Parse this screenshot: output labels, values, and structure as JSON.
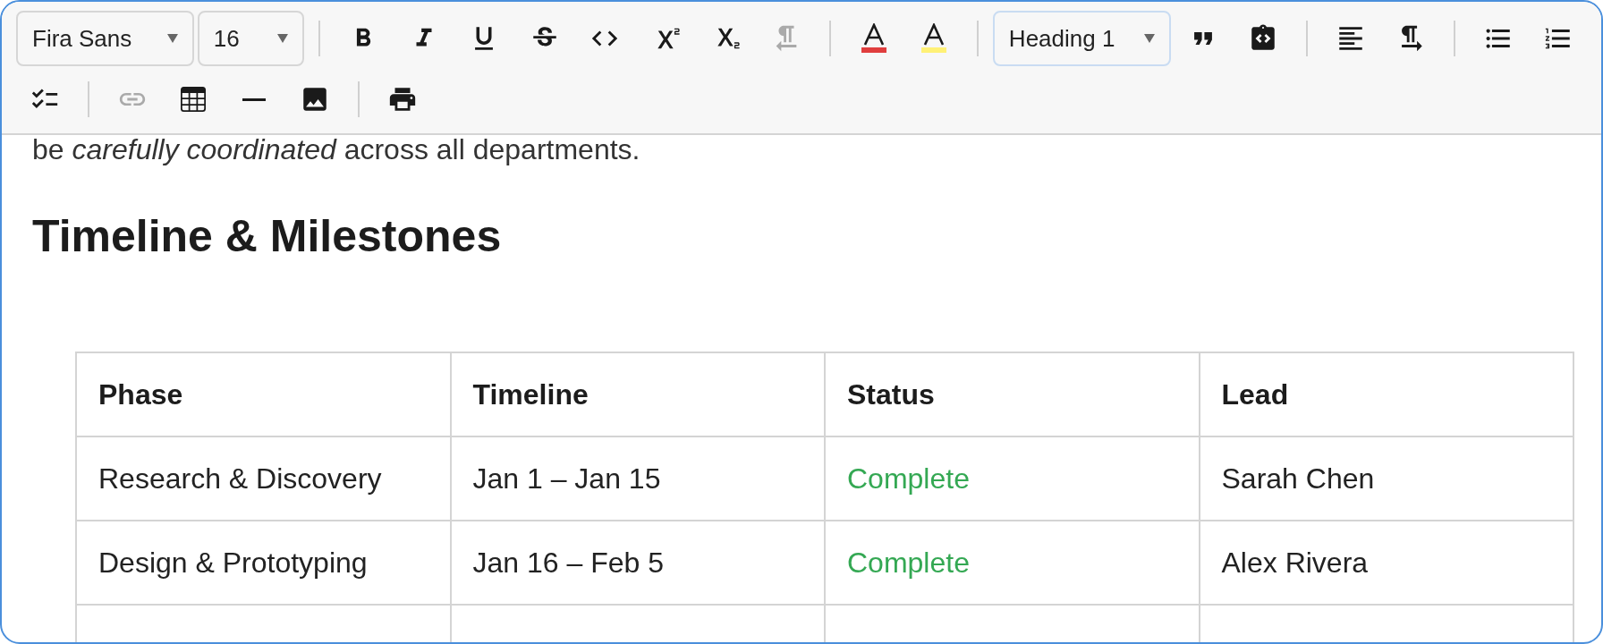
{
  "toolbar": {
    "rows": [
      [
        {
          "kind": "select",
          "value": "Fira Sans",
          "focused": false
        },
        {
          "kind": "select",
          "value": "16",
          "focused": false
        },
        {
          "kind": "separator"
        },
        {
          "kind": "button",
          "disabled": false
        },
        {
          "kind": "button",
          "disabled": false
        },
        {
          "kind": "button",
          "disabled": false
        },
        {
          "kind": "button",
          "disabled": false
        },
        {
          "kind": "button",
          "disabled": false
        },
        {
          "kind": "button",
          "disabled": false
        },
        {
          "kind": "button",
          "disabled": false
        },
        {
          "kind": "button",
          "disabled": true
        },
        {
          "kind": "separator"
        },
        {
          "kind": "color",
          "color": "#e03e3e",
          "disabled": false
        },
        {
          "kind": "color",
          "color": "#fff176",
          "disabled": false
        },
        {
          "kind": "separator"
        },
        {
          "kind": "select",
          "value": "Heading 1",
          "focused": true
        },
        {
          "kind": "button",
          "disabled": false
        },
        {
          "kind": "button",
          "disabled": false
        },
        {
          "kind": "separator"
        },
        {
          "kind": "button",
          "disabled": false
        },
        {
          "kind": "button",
          "disabled": false
        },
        {
          "kind": "separator"
        },
        {
          "kind": "button",
          "disabled": false
        },
        {
          "kind": "button",
          "disabled": false
        }
      ],
      [
        {
          "kind": "button",
          "disabled": false
        },
        {
          "kind": "separator"
        },
        {
          "kind": "button",
          "disabled": true
        },
        {
          "kind": "button",
          "disabled": false
        },
        {
          "kind": "button",
          "disabled": false
        },
        {
          "kind": "button",
          "disabled": false
        },
        {
          "kind": "separator"
        },
        {
          "kind": "button",
          "disabled": false
        }
      ]
    ]
  },
  "document": {
    "paragraph": "be *carefully coordinated* across all departments.",
    "heading": "Timeline & Milestones",
    "table": {
      "columns": [
        "Phase",
        "Timeline",
        "Status",
        "Lead"
      ],
      "rows": [
        {
          "cells": [
            "Research & Discovery",
            "Jan 1 – Jan 15",
            "Complete",
            "Sarah Chen"
          ],
          "color": "#34a853"
        },
        {
          "cells": [
            "Design & Prototyping",
            "Jan 16 – Feb 5",
            "Complete",
            "Alex Rivera"
          ],
          "color": "#34a853"
        }
      ],
      "cut_off_row": true
    }
  }
}
